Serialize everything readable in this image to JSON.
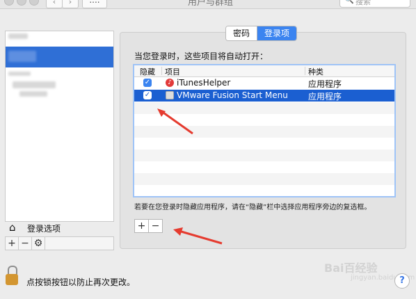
{
  "window": {
    "title": "用户与群组",
    "grid_button": "....",
    "search_placeholder": "搜索"
  },
  "sidebar": {
    "login_options_label": "登录选项",
    "footer_buttons": [
      "+",
      "−",
      "⚙"
    ]
  },
  "tabs": {
    "password": "密码",
    "login_items": "登录项"
  },
  "main": {
    "intro": "当您登录时，这些项目将自动打开：",
    "columns": {
      "hide": "隐藏",
      "item": "项目",
      "kind": "种类"
    },
    "rows": [
      {
        "name": "iTunesHelper",
        "kind": "应用程序",
        "checked": true
      },
      {
        "name": "VMware Fusion Start Menu",
        "kind": "应用程序",
        "checked": true
      }
    ],
    "hint": "若要在您登录时隐藏应用程序，请在“隐藏”栏中选择应用程序旁边的复选框。",
    "add_label": "+",
    "remove_label": "−"
  },
  "lock_text": "点按锁按钮以防止再次更改。",
  "watermark": {
    "text": "Bai百经验",
    "sub": "jingyan.baidu.com"
  },
  "help_label": "?"
}
